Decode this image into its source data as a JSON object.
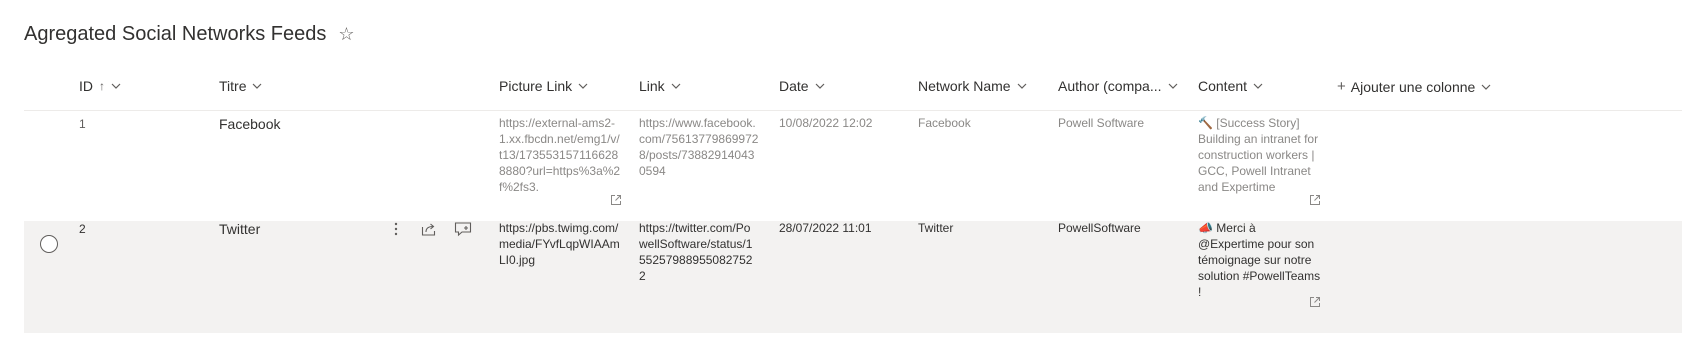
{
  "page": {
    "title": "Agregated Social Networks Feeds"
  },
  "columns": {
    "id": "ID",
    "title": "Titre",
    "picture": "Picture Link",
    "link": "Link",
    "date": "Date",
    "network": "Network Name",
    "author": "Author (compa...",
    "content": "Content",
    "add": "Ajouter une colonne"
  },
  "rows": [
    {
      "id": "1",
      "title": "Facebook",
      "picture": "https://external-ams2-1.xx.fbcdn.net/emg1/v/t13/1735531571166288880?url=https%3a%2f%2fs3.",
      "link": "https://www.facebook.com/756137798699728/posts/738829140430594",
      "date": "10/08/2022 12:02",
      "network": "Facebook",
      "author": "Powell Software",
      "content": "🔨 [Success Story] Building an intranet for construction workers | GCC, Powell Intranet and Expertime"
    },
    {
      "id": "2",
      "title": "Twitter",
      "picture": "https://pbs.twimg.com/media/FYvfLqpWIAAmLI0.jpg",
      "link": "https://twitter.com/PowellSoftware/status/1552579889550827522",
      "date": "28/07/2022 11:01",
      "network": "Twitter",
      "author": "PowellSoftware",
      "content": "📣 Merci à @Expertime pour son témoignage sur notre solution #PowellTeams !"
    }
  ]
}
